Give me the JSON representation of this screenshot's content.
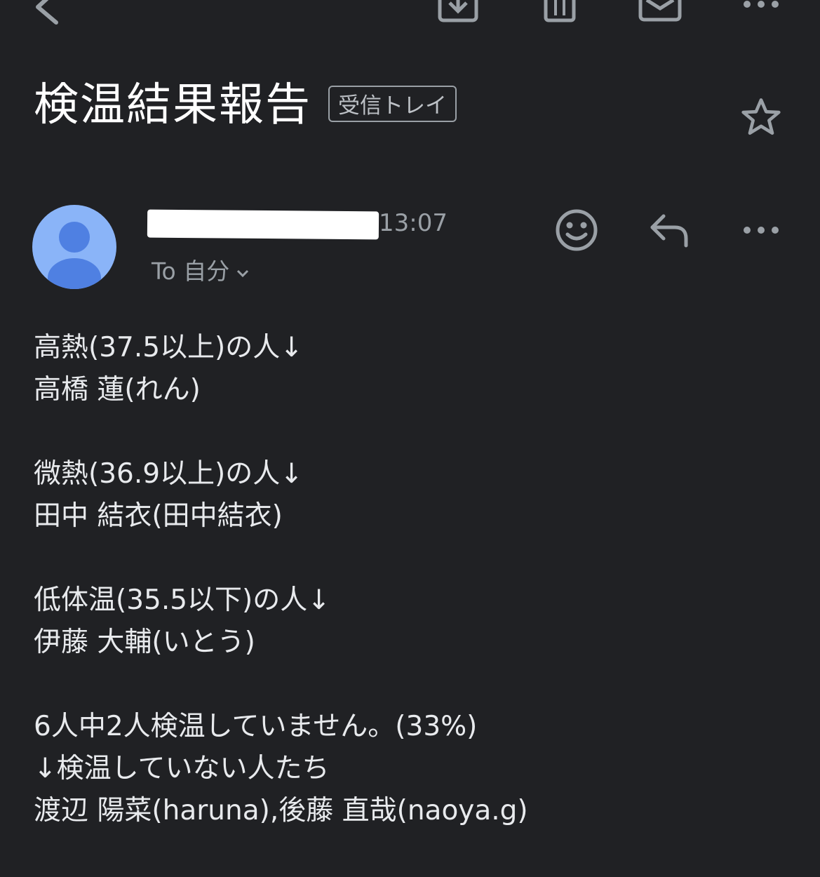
{
  "toolbar": {
    "back_icon": "back-arrow-icon",
    "archive_icon": "archive-icon",
    "delete_icon": "trash-icon",
    "mark_unread_icon": "mail-icon",
    "more_icon": "more-horizontal-icon"
  },
  "subject": {
    "title": "検温結果報告",
    "label": "受信トレイ",
    "star_icon": "star-icon"
  },
  "message": {
    "time": "13:07",
    "recipient": "To 自分",
    "actions": {
      "emoji_icon": "smiley-icon",
      "reply_icon": "reply-icon",
      "more_icon": "more-horizontal-icon"
    },
    "body_lines": [
      "高熱(37.5以上)の人↓",
      "高橋 蓮(れん)",
      "",
      "微熱(36.9以上)の人↓",
      "田中 結衣(田中結衣)",
      "",
      "低体温(35.5以下)の人↓",
      "伊藤 大輔(いとう)",
      "",
      "6人中2人検温していません。(33%)",
      "↓検温していない人たち",
      "渡辺 陽菜(haruna),後藤 直哉(naoya.g)"
    ]
  },
  "colors": {
    "background": "#202124",
    "text": "#e8eaed",
    "muted": "#9aa0a6",
    "avatar_bg": "#8ab4f8",
    "avatar_fg": "#4f80e2"
  }
}
